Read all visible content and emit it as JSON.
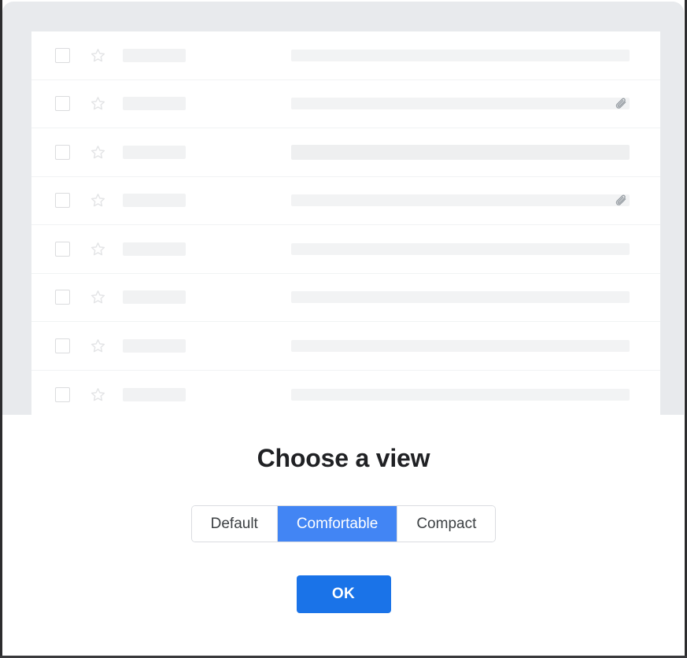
{
  "window": {
    "frame_color": "#2c2c2e",
    "backdrop_color": "#e8eaed"
  },
  "mail_list": {
    "panel_background": "#ffffff",
    "divider_color": "#f1f3f4",
    "skeleton_color": "#f1f2f3",
    "rows": [
      {
        "checkbox_checked": false,
        "starred": false,
        "unread": false,
        "has_attachment": false,
        "subject_width": 430
      },
      {
        "checkbox_checked": false,
        "starred": false,
        "unread": false,
        "has_attachment": true,
        "subject_width": 430
      },
      {
        "checkbox_checked": false,
        "starred": false,
        "unread": true,
        "has_attachment": false,
        "subject_width": 430
      },
      {
        "checkbox_checked": false,
        "starred": false,
        "unread": false,
        "has_attachment": true,
        "subject_width": 430
      },
      {
        "checkbox_checked": false,
        "starred": false,
        "unread": false,
        "has_attachment": false,
        "subject_width": 430
      },
      {
        "checkbox_checked": false,
        "starred": false,
        "unread": false,
        "has_attachment": false,
        "subject_width": 430
      },
      {
        "checkbox_checked": false,
        "starred": false,
        "unread": false,
        "has_attachment": false,
        "subject_width": 430
      },
      {
        "checkbox_checked": false,
        "starred": false,
        "unread": false,
        "has_attachment": false,
        "subject_width": 430
      }
    ],
    "icons": {
      "checkbox": "checkbox-unchecked-icon",
      "star": "star-outline-icon",
      "attachment": "paperclip-icon"
    }
  },
  "dialog": {
    "title": "Choose a view",
    "title_color": "#202124",
    "segmented_control": {
      "options": [
        {
          "label": "Default",
          "selected": false
        },
        {
          "label": "Comfortable",
          "selected": true
        },
        {
          "label": "Compact",
          "selected": false
        }
      ],
      "selected_value": "Comfortable",
      "selected_background": "#4285f4",
      "border_color": "#dadce0"
    },
    "confirm_button": {
      "label": "OK",
      "background": "#1a73e8",
      "text_color": "#ffffff"
    }
  }
}
